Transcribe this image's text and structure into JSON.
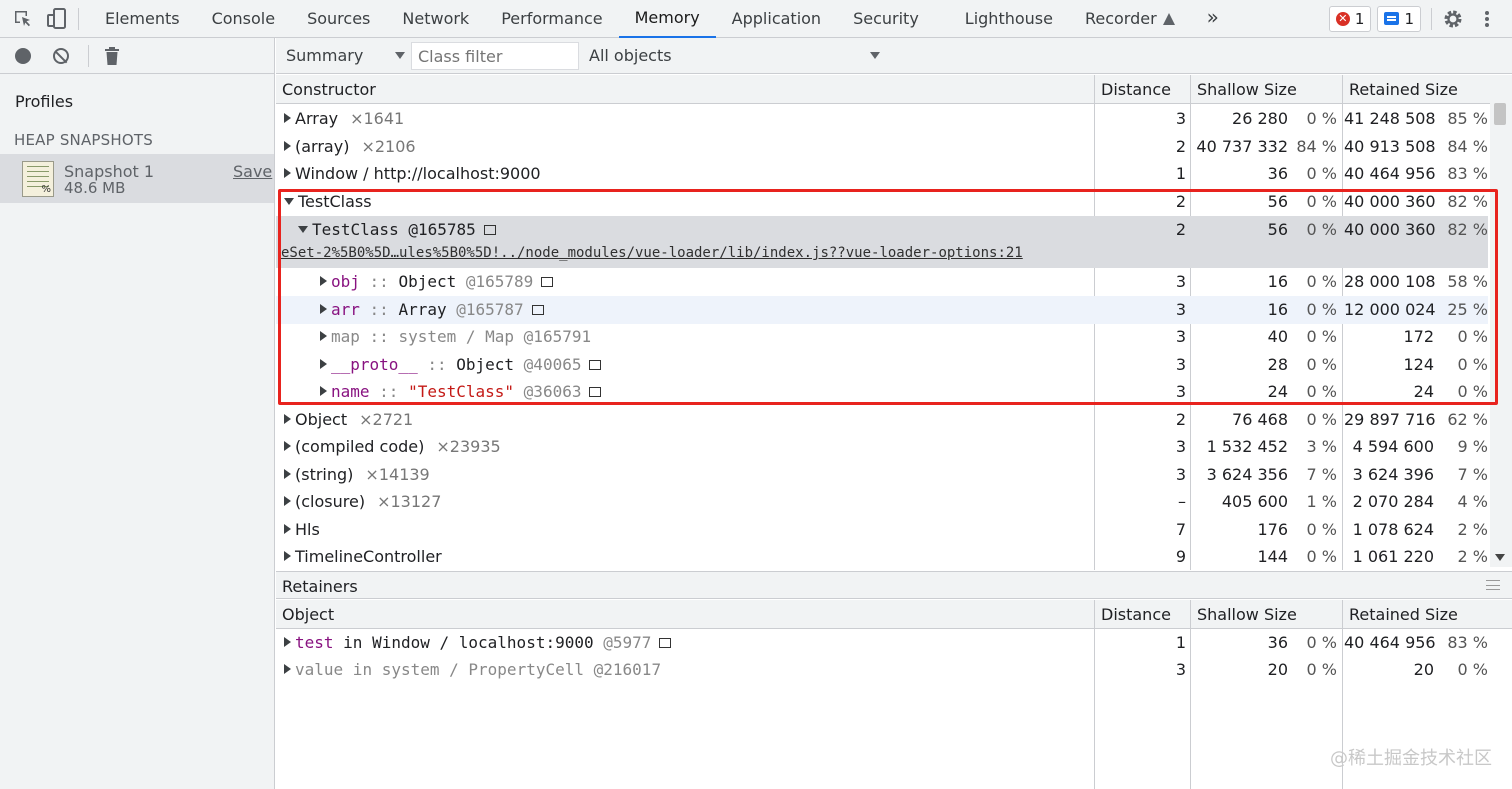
{
  "top_tabs": [
    "Elements",
    "Console",
    "Sources",
    "Network",
    "Performance",
    "Memory",
    "Application",
    "Security",
    "Lighthouse",
    "Recorder"
  ],
  "active_tab": "Memory",
  "overflow_label": "»",
  "error_count": "1",
  "message_count": "1",
  "sidebar": {
    "profiles_title": "Profiles",
    "heap_header": "HEAP SNAPSHOTS",
    "snapshot_name": "Snapshot 1",
    "snapshot_size": "48.6 MB",
    "save_label": "Save"
  },
  "toolbar": {
    "view_select": "Summary",
    "class_filter_placeholder": "Class filter",
    "objects_select": "All objects"
  },
  "summary_headers": {
    "constructor": "Constructor",
    "distance": "Distance",
    "shallow": "Shallow Size",
    "retained": "Retained Size"
  },
  "summary_rows": [
    {
      "label": "Array",
      "count": "×1641",
      "distance": "3",
      "shallow": "26 280",
      "shallow_pct": "0 %",
      "retained": "41 248 508",
      "retained_pct": "85 %"
    },
    {
      "label": "(array)",
      "count": "×2106",
      "distance": "2",
      "shallow": "40 737 332",
      "shallow_pct": "84 %",
      "retained": "40 913 508",
      "retained_pct": "84 %"
    },
    {
      "label": "Window / http://localhost:9000",
      "count": "",
      "distance": "1",
      "shallow": "36",
      "shallow_pct": "0 %",
      "retained": "40 464 956",
      "retained_pct": "83 %"
    },
    {
      "label": "TestClass",
      "count": "",
      "distance": "2",
      "shallow": "56",
      "shallow_pct": "0 %",
      "retained": "40 000 360",
      "retained_pct": "82 %"
    },
    {
      "label": "TestClass",
      "id": "@165785",
      "source_link": "eSet-2%5B0%5D…ules%5B0%5D!../node_modules/vue-loader/lib/index.js??vue-loader-options:21",
      "distance": "2",
      "shallow": "56",
      "shallow_pct": "0 %",
      "retained": "40 000 360",
      "retained_pct": "82 %"
    },
    {
      "prop": "obj",
      "sep": " :: ",
      "type": "Object",
      "id": "@165789",
      "distance": "3",
      "shallow": "16",
      "shallow_pct": "0 %",
      "retained": "28 000 108",
      "retained_pct": "58 %"
    },
    {
      "prop": "arr",
      "sep": " :: ",
      "type": "Array",
      "id": "@165787",
      "distance": "3",
      "shallow": "16",
      "shallow_pct": "0 %",
      "retained": "12 000 024",
      "retained_pct": "25 %"
    },
    {
      "prop": "map",
      "sep": " :: ",
      "type": "system / Map",
      "id": "@165791",
      "distance": "3",
      "shallow": "40",
      "shallow_pct": "0 %",
      "retained": "172",
      "retained_pct": "0 %"
    },
    {
      "prop": "__proto__",
      "sep": " :: ",
      "type": "Object",
      "id": "@40065",
      "distance": "3",
      "shallow": "28",
      "shallow_pct": "0 %",
      "retained": "124",
      "retained_pct": "0 %"
    },
    {
      "prop": "name",
      "sep": " :: ",
      "type": "\"TestClass\"",
      "id": "@36063",
      "distance": "3",
      "shallow": "24",
      "shallow_pct": "0 %",
      "retained": "24",
      "retained_pct": "0 %"
    },
    {
      "label": "Object",
      "count": "×2721",
      "distance": "2",
      "shallow": "76 468",
      "shallow_pct": "0 %",
      "retained": "29 897 716",
      "retained_pct": "62 %"
    },
    {
      "label": "(compiled code)",
      "count": "×23935",
      "distance": "3",
      "shallow": "1 532 452",
      "shallow_pct": "3 %",
      "retained": "4 594 600",
      "retained_pct": "9 %"
    },
    {
      "label": "(string)",
      "count": "×14139",
      "distance": "3",
      "shallow": "3 624 356",
      "shallow_pct": "7 %",
      "retained": "3 624 396",
      "retained_pct": "7 %"
    },
    {
      "label": "(closure)",
      "count": "×13127",
      "distance": "–",
      "shallow": "405 600",
      "shallow_pct": "1 %",
      "retained": "2 070 284",
      "retained_pct": "4 %"
    },
    {
      "label": "Hls",
      "count": "",
      "distance": "7",
      "shallow": "176",
      "shallow_pct": "0 %",
      "retained": "1 078 624",
      "retained_pct": "2 %"
    },
    {
      "label": "TimelineController",
      "count": "",
      "distance": "9",
      "shallow": "144",
      "shallow_pct": "0 %",
      "retained": "1 061 220",
      "retained_pct": "2 %"
    }
  ],
  "retainers": {
    "title": "Retainers",
    "headers": {
      "object": "Object",
      "distance": "Distance",
      "shallow": "Shallow Size",
      "retained": "Retained Size"
    },
    "rows": [
      {
        "prop": "test",
        "in": " in ",
        "owner": "Window / localhost:9000",
        "id": "@5977",
        "distance": "1",
        "shallow": "36",
        "shallow_pct": "0 %",
        "retained": "40 464 956",
        "retained_pct": "83 %"
      },
      {
        "prop": "value",
        "in": " in ",
        "owner": "system / PropertyCell",
        "id": "@216017",
        "distance": "3",
        "shallow": "20",
        "shallow_pct": "0 %",
        "retained": "20",
        "retained_pct": "0 %"
      }
    ]
  },
  "watermark": "@稀土掘金技术社区"
}
